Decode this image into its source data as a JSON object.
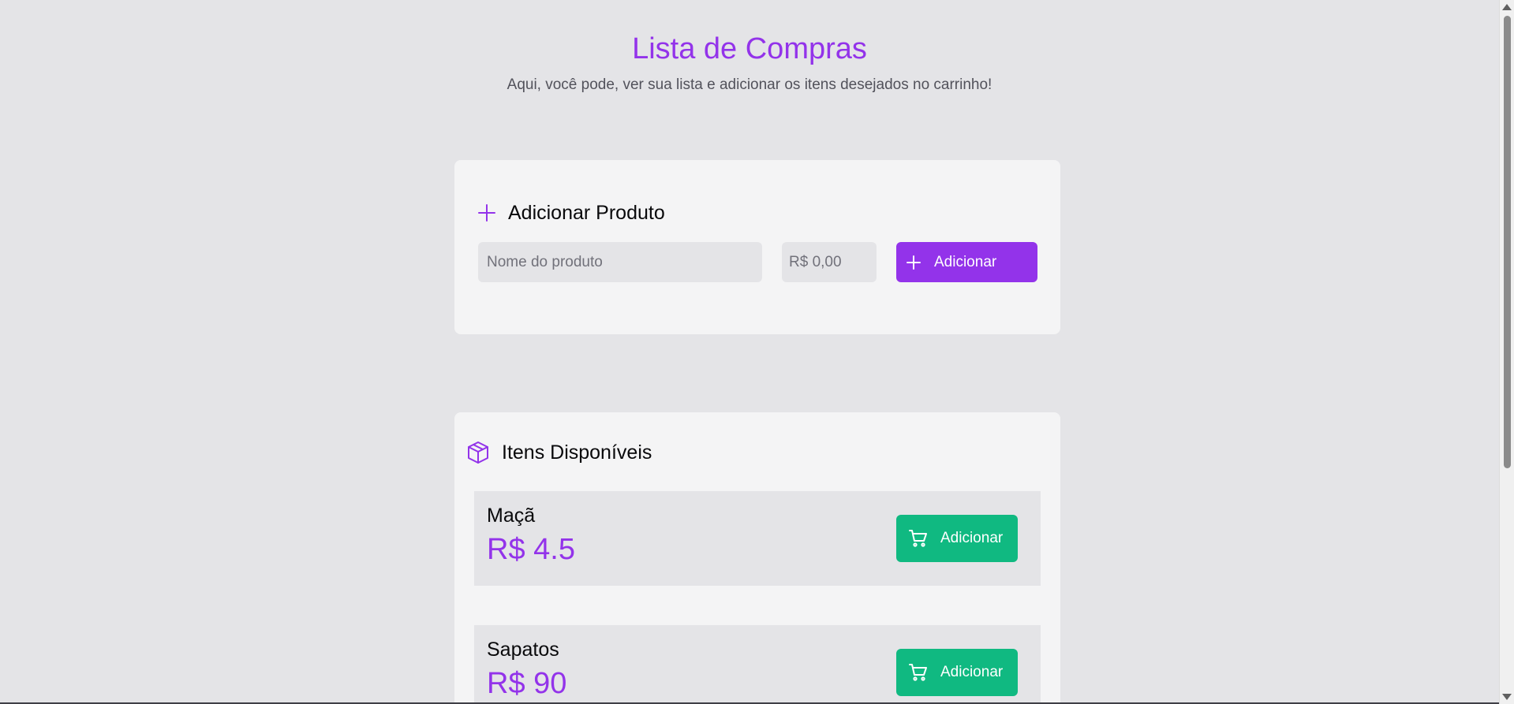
{
  "header": {
    "title": "Lista de Compras",
    "subtitle": "Aqui, você pode, ver sua lista e adicionar os itens desejados no carrinho!"
  },
  "add_product": {
    "icon": "plus-icon",
    "title": "Adicionar Produto",
    "name_placeholder": "Nome do produto",
    "price_placeholder": "R$ 0,00",
    "button_label": "Adicionar",
    "button_icon": "plus-icon"
  },
  "available_items": {
    "icon": "package-icon",
    "title": "Itens Disponíveis",
    "items": [
      {
        "name": "Maçã",
        "price": "R$ 4.5",
        "button_label": "Adicionar",
        "button_icon": "cart-icon"
      },
      {
        "name": "Sapatos",
        "price": "R$ 90",
        "button_label": "Adicionar",
        "button_icon": "cart-icon"
      }
    ]
  },
  "colors": {
    "accent": "#9333ea",
    "success": "#10b981",
    "background": "#e4e4e7",
    "card": "#f4f4f5"
  }
}
